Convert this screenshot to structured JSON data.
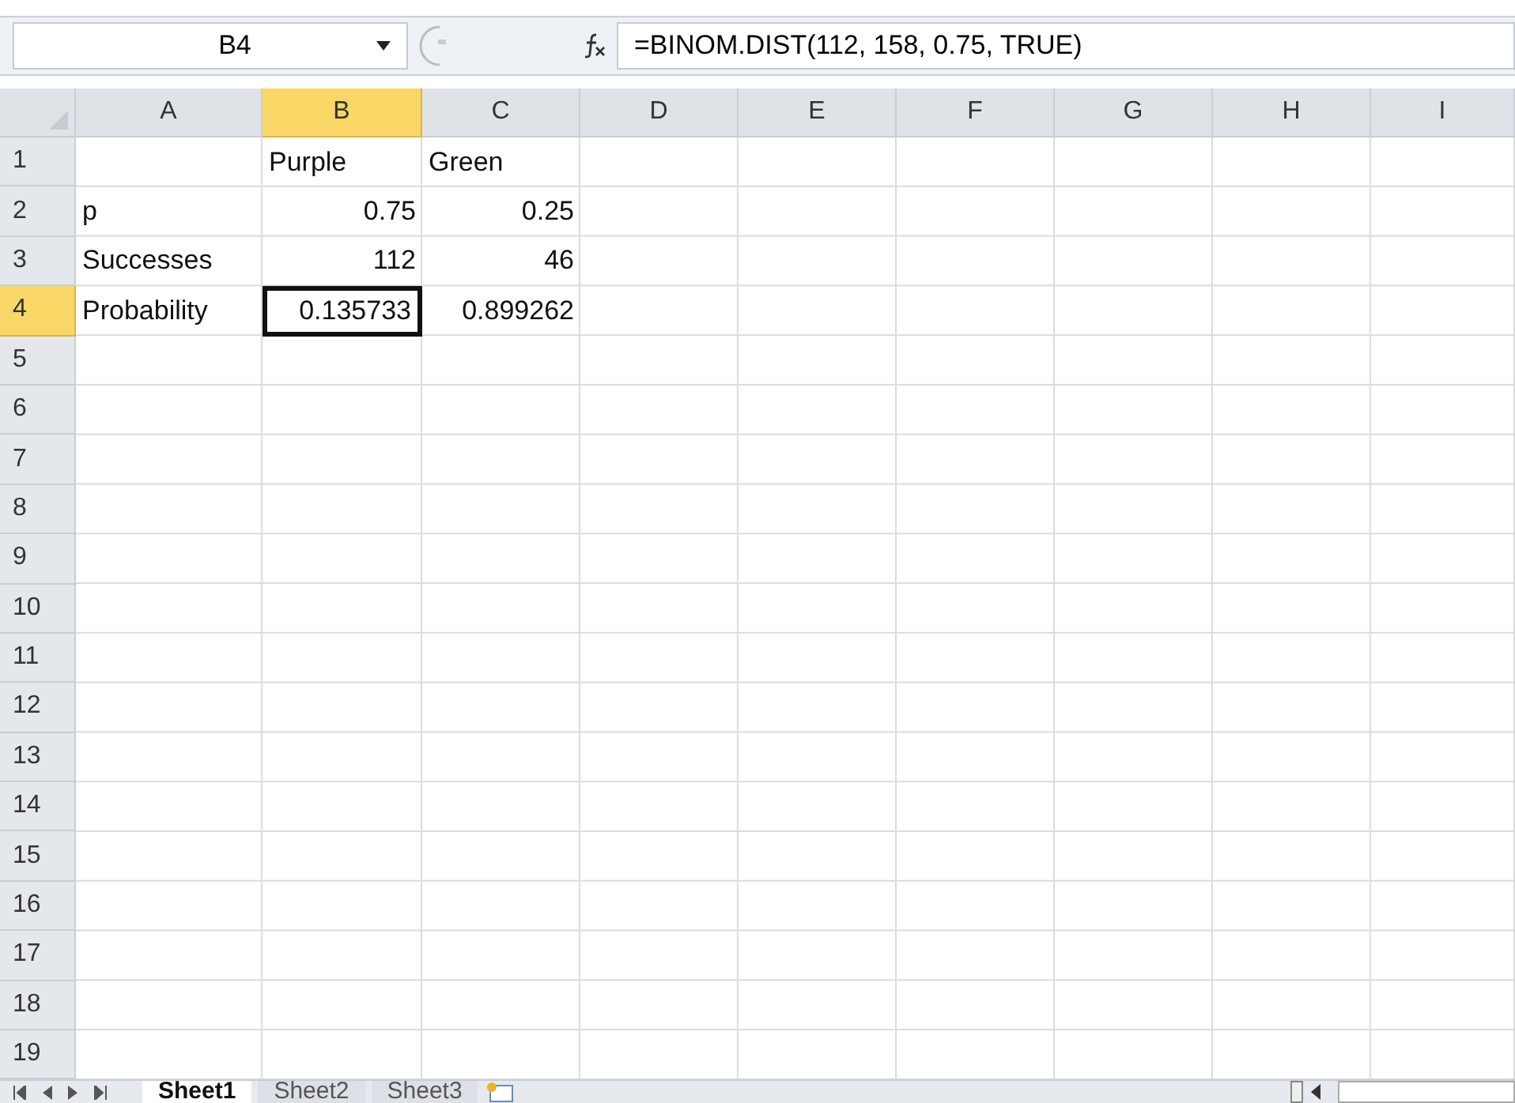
{
  "name_box": "B4",
  "formula": "=BINOM.DIST(112, 158, 0.75, TRUE)",
  "columns": [
    {
      "label": "A",
      "selected": false
    },
    {
      "label": "B",
      "selected": true
    },
    {
      "label": "C",
      "selected": false
    },
    {
      "label": "D",
      "selected": false
    },
    {
      "label": "E",
      "selected": false
    },
    {
      "label": "F",
      "selected": false
    },
    {
      "label": "G",
      "selected": false
    },
    {
      "label": "H",
      "selected": false
    },
    {
      "label": "I",
      "selected": false
    }
  ],
  "rows": [
    {
      "label": "1",
      "selected": false,
      "cells": [
        {
          "kind": "blank"
        },
        {
          "kind": "text",
          "text": "Purple",
          "selected": false
        },
        {
          "kind": "text",
          "text": "Green",
          "selected": false
        }
      ]
    },
    {
      "label": "2",
      "selected": false,
      "cells": [
        {
          "kind": "text",
          "text": "p",
          "selected": false
        },
        {
          "kind": "number",
          "text": "0.75",
          "selected": false
        },
        {
          "kind": "number",
          "text": "0.25",
          "selected": false
        }
      ]
    },
    {
      "label": "3",
      "selected": false,
      "cells": [
        {
          "kind": "text",
          "text": "Successes",
          "selected": false
        },
        {
          "kind": "number",
          "text": "112",
          "selected": false
        },
        {
          "kind": "number",
          "text": "46",
          "selected": false
        }
      ]
    },
    {
      "label": "4",
      "selected": true,
      "cells": [
        {
          "kind": "text",
          "text": "Probability",
          "selected": false
        },
        {
          "kind": "number",
          "text": "0.135733",
          "selected": true
        },
        {
          "kind": "number",
          "text": "0.899262",
          "selected": false
        }
      ]
    },
    {
      "label": "5",
      "selected": false,
      "cells": []
    },
    {
      "label": "6",
      "selected": false,
      "cells": []
    },
    {
      "label": "7",
      "selected": false,
      "cells": []
    },
    {
      "label": "8",
      "selected": false,
      "cells": []
    },
    {
      "label": "9",
      "selected": false,
      "cells": []
    },
    {
      "label": "10",
      "selected": false,
      "cells": []
    },
    {
      "label": "11",
      "selected": false,
      "cells": []
    },
    {
      "label": "12",
      "selected": false,
      "cells": []
    },
    {
      "label": "13",
      "selected": false,
      "cells": []
    },
    {
      "label": "14",
      "selected": false,
      "cells": []
    },
    {
      "label": "15",
      "selected": false,
      "cells": []
    },
    {
      "label": "16",
      "selected": false,
      "cells": []
    },
    {
      "label": "17",
      "selected": false,
      "cells": []
    },
    {
      "label": "18",
      "selected": false,
      "cells": []
    },
    {
      "label": "19",
      "selected": false,
      "cells": []
    }
  ],
  "sheet_tabs": [
    {
      "label": "Sheet1",
      "selected": true
    },
    {
      "label": "Sheet2",
      "selected": false
    },
    {
      "label": "Sheet3",
      "selected": false
    }
  ]
}
